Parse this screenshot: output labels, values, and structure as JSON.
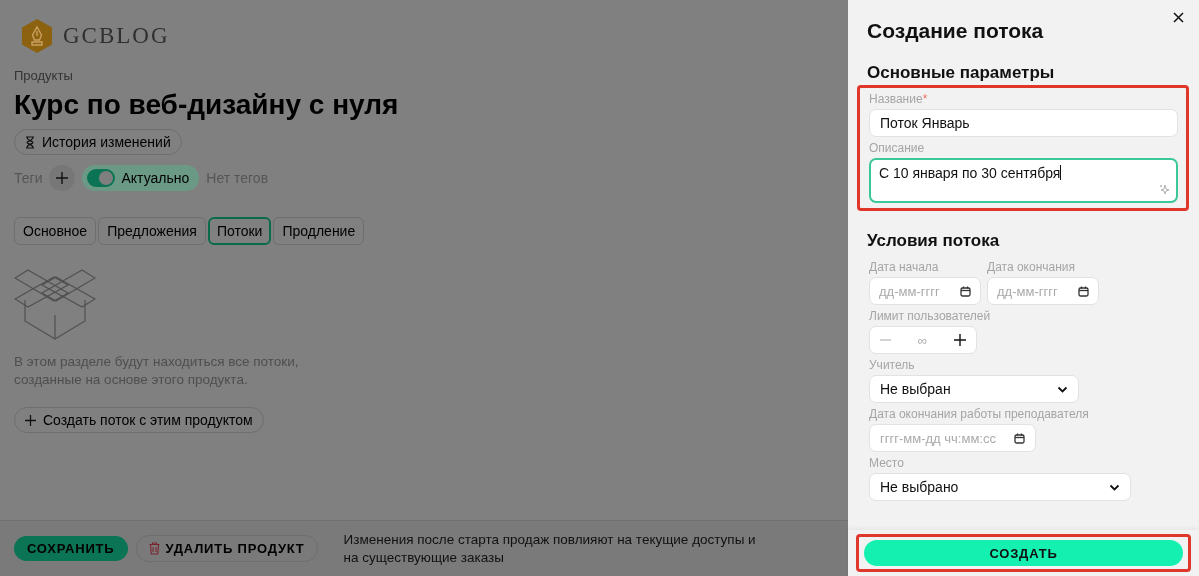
{
  "logo": {
    "text": "GCBLOG"
  },
  "breadcrumb": "Продукты",
  "title": "Курс по веб-дизайну с нуля",
  "history_button": "История изменений",
  "tags": {
    "label": "Теги",
    "toggle": {
      "label": "Актуально",
      "on": true
    },
    "empty_text": "Нет тегов"
  },
  "tabs": [
    {
      "label": "Основное",
      "selected": false
    },
    {
      "label": "Предложения",
      "selected": false
    },
    {
      "label": "Потоки",
      "selected": true
    },
    {
      "label": "Продление",
      "selected": false
    }
  ],
  "empty_state": {
    "text": "В этом разделе будут находиться все потоки, созданные на основе этого продукта.",
    "button": "Создать поток с этим продуктом"
  },
  "footer": {
    "save_button": "СОХРАНИТЬ",
    "delete_button": "УДАЛИТЬ ПРОДУКТ",
    "note": "Изменения после старта продаж повлияют на текущие доступы и на существующие заказы"
  },
  "drawer": {
    "title": "Создание потока",
    "sections": [
      {
        "heading": "Основные параметры",
        "highlighted": true,
        "fields": [
          {
            "kind": "text",
            "label": "Название",
            "required_mark": "*",
            "value": "Поток Январь",
            "focused": false
          },
          {
            "kind": "textarea",
            "label": "Описание",
            "value": "С 10 января по 30 сентября",
            "focused": true
          }
        ]
      },
      {
        "heading": "Условия потока",
        "highlighted": false,
        "fields": [
          {
            "kind": "date_range",
            "items": [
              {
                "label": "Дата начала",
                "placeholder": "дд-мм-гггг"
              },
              {
                "label": "Дата окончания",
                "placeholder": "дд-мм-гггг"
              }
            ]
          },
          {
            "kind": "stepper",
            "label": "Лимит пользователей",
            "value": "∞"
          },
          {
            "kind": "select",
            "label": "Учитель",
            "value": "Не выбран",
            "wide": false
          },
          {
            "kind": "datetime",
            "label": "Дата окончания работы преподавателя",
            "placeholder": "гггг-мм-дд чч:мм:сс"
          },
          {
            "kind": "select",
            "label": "Место",
            "value": "Не выбрано",
            "wide": true
          }
        ]
      }
    ],
    "create_button": {
      "label": "СОЗДАТЬ",
      "highlighted": true
    }
  }
}
